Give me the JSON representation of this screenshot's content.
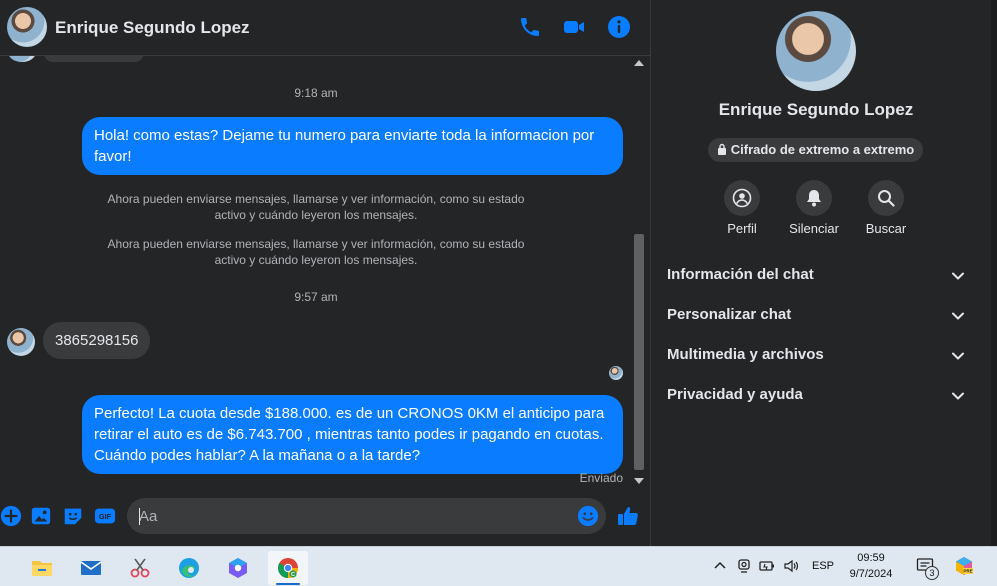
{
  "header": {
    "contact_name": "Enrique Segundo Lopez"
  },
  "messages": {
    "timestamp_1": "9:18 am",
    "outgoing_1": "Hola! como estas? Dejame tu numero para enviarte toda la informacion por favor!",
    "system_1": "Ahora pueden enviarse mensajes, llamarse y ver información, como su estado activo y cuándo leyeron los mensajes.",
    "system_2": "Ahora pueden enviarse mensajes, llamarse y ver información, como su estado activo y cuándo leyeron los mensajes.",
    "timestamp_2": "9:57 am",
    "incoming_1": "3865298156",
    "outgoing_2": "Perfecto! La cuota desde $188.000. es de un CRONOS 0KM el anticipo para retirar el auto es de $6.743.700 , mientras tanto podes ir pagando en cuotas. Cuándo podes hablar? A la mañana o a la tarde?",
    "status": "Enviado"
  },
  "composer": {
    "placeholder": "Aa"
  },
  "details": {
    "name": "Enrique Segundo Lopez",
    "encryption_badge": "Cifrado de extremo a extremo",
    "actions": [
      {
        "label": "Perfil",
        "icon": "user-icon"
      },
      {
        "label": "Silenciar",
        "icon": "bell-icon"
      },
      {
        "label": "Buscar",
        "icon": "search-icon"
      }
    ],
    "sections": [
      {
        "label": "Información del chat"
      },
      {
        "label": "Personalizar chat"
      },
      {
        "label": "Multimedia y archivos"
      },
      {
        "label": "Privacidad y ayuda"
      }
    ]
  },
  "taskbar": {
    "apps": [
      "file-explorer-icon",
      "mail-icon",
      "snipping-tool-icon",
      "edge-icon",
      "copilot-icon",
      "chrome-icon"
    ],
    "language": "ESP",
    "time": "09:59",
    "date": "9/7/2024",
    "notification_count": "3"
  },
  "colors": {
    "accent": "#0a7cff",
    "background": "#242526",
    "bubble_in": "#3a3b3c"
  }
}
